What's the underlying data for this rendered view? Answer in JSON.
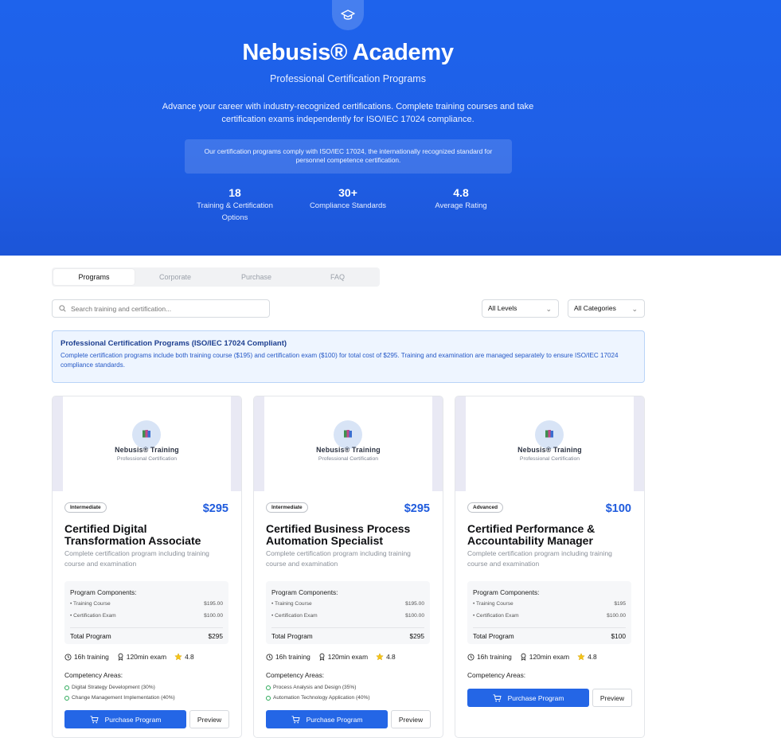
{
  "hero": {
    "title": "Nebusis® Academy",
    "subtitle": "Professional Certification Programs",
    "description": "Advance your career with industry-recognized certifications. Complete training courses and take certification exams independently for ISO/IEC 17024 compliance.",
    "note": "Our certification programs comply with ISO/IEC 17024, the internationally recognized standard for personnel competence certification.",
    "icon": "graduation-cap-icon",
    "stats": [
      {
        "value": "18",
        "label": "Training & Certification Options"
      },
      {
        "value": "30+",
        "label": "Compliance Standards"
      },
      {
        "value": "4.8",
        "label": "Average Rating"
      }
    ]
  },
  "tabs": [
    "Programs",
    "Corporate",
    "Purchase",
    "FAQ"
  ],
  "active_tab": "Programs",
  "search": {
    "placeholder": "Search training and certification..."
  },
  "filters": {
    "level": "All Levels",
    "category": "All Categories"
  },
  "info": {
    "title": "Professional Certification Programs (ISO/IEC 17024 Compliant)",
    "text": "Complete certification programs include both training course ($195) and certification exam ($100) for total cost of $295. Training and examination are managed separately to ensure ISO/IEC 17024 compliance standards."
  },
  "colors": {
    "accent": "#2466e6",
    "hero": "#1f5fe6",
    "price": "#1f5bdd"
  },
  "cards": [
    {
      "brand": "Nebusis® Training",
      "brand_tag": "Professional Certification",
      "level": "Intermediate",
      "price": "$295",
      "title": "Certified Digital Transformation Associate",
      "description": "Complete certification program including training course and examination",
      "components_title": "Program Components:",
      "components": [
        {
          "label": "• Training Course",
          "value": "$195.00"
        },
        {
          "label": "• Certification Exam",
          "value": "$100.00"
        }
      ],
      "total_label": "Total Program",
      "total_value": "$295",
      "training": "16h training",
      "exam": "120min exam",
      "rating": "4.8",
      "areas_title": "Competency Areas:",
      "areas": [
        "Digital Strategy Development (30%)",
        "Change Management Implementation (40%)"
      ],
      "buy_label": "Purchase Program",
      "preview_label": "Preview"
    },
    {
      "brand": "Nebusis® Training",
      "brand_tag": "Professional Certification",
      "level": "Intermediate",
      "price": "$295",
      "title": "Certified Business Process Automation Specialist",
      "description": "Complete certification program including training course and examination",
      "components_title": "Program Components:",
      "components": [
        {
          "label": "• Training Course",
          "value": "$195.00"
        },
        {
          "label": "• Certification Exam",
          "value": "$100.00"
        }
      ],
      "total_label": "Total Program",
      "total_value": "$295",
      "training": "16h training",
      "exam": "120min exam",
      "rating": "4.8",
      "areas_title": "Competency Areas:",
      "areas": [
        "Process Analysis and Design (35%)",
        "Automation Technology Application (40%)"
      ],
      "buy_label": "Purchase Program",
      "preview_label": "Preview"
    },
    {
      "brand": "Nebusis® Training",
      "brand_tag": "Professional Certification",
      "level": "Advanced",
      "price": "$100",
      "title": "Certified Performance & Accountability Manager",
      "description": "Complete certification program including training course and examination",
      "components_title": "Program Components:",
      "components": [
        {
          "label": "• Training Course",
          "value": "$195"
        },
        {
          "label": "• Certification Exam",
          "value": "$100.00"
        }
      ],
      "total_label": "Total Program",
      "total_value": "$100",
      "training": "16h training",
      "exam": "120min exam",
      "rating": "4.8",
      "areas_title": "Competency Areas:",
      "areas": [],
      "buy_label": "Purchase Program",
      "preview_label": "Preview"
    }
  ]
}
